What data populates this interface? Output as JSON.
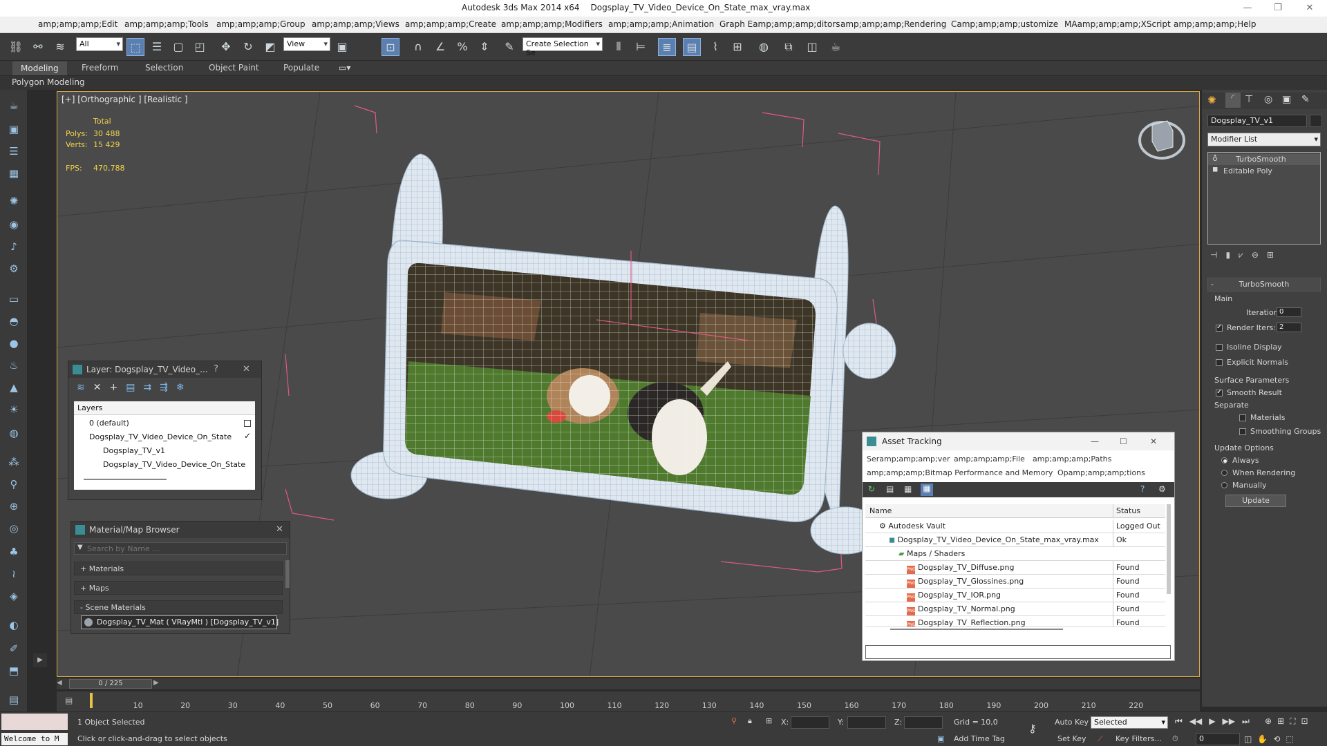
{
  "window": {
    "app_title": "Autodesk 3ds Max  2014 x64",
    "file_title": "Dogsplay_TV_Video_Device_On_State_max_vray.max",
    "minimize": "—",
    "restore": "❐",
    "close": "✕"
  },
  "menu": [
    "amp;amp;amp;Edit",
    "amp;amp;amp;Tools",
    "amp;amp;amp;Group",
    "amp;amp;amp;Views",
    "amp;amp;amp;Create",
    "amp;amp;amp;Modifiers",
    "amp;amp;amp;Animation",
    "Graph Eamp;amp;amp;ditors",
    "amp;amp;amp;Rendering",
    "Camp;amp;amp;ustomize",
    "MAamp;amp;amp;XScript",
    "amp;amp;amp;Help"
  ],
  "toolbar": {
    "selection_filter": "All",
    "ref_coord": "View",
    "named_selection": "Create Selection Se"
  },
  "ribbon": {
    "tabs": [
      "Modeling",
      "Freeform",
      "Selection",
      "Object Paint",
      "Populate"
    ],
    "active": "Modeling",
    "sub_label": "Polygon Modeling"
  },
  "viewport": {
    "label": "[+] [Orthographic ] [Realistic ]",
    "stats_total": "Total",
    "polys_label": "Polys:",
    "polys_value": "30 488",
    "verts_label": "Verts:",
    "verts_value": "15 429",
    "fps_label": "FPS:",
    "fps_value": "470,788"
  },
  "layer_panel": {
    "title": "Layer: Dogsplay_TV_Video_...",
    "help": "?",
    "close": "✕",
    "header": "Layers",
    "rows": [
      "0 (default)",
      "Dogsplay_TV_Video_Device_On_State",
      "Dogsplay_TV_v1",
      "Dogsplay_TV_Video_Device_On_State"
    ]
  },
  "material_browser": {
    "title": "Material/Map Browser",
    "close": "✕",
    "search_placeholder": "Search by Name ...",
    "groups": [
      "+ Materials",
      "+ Maps",
      "- Scene Materials"
    ],
    "scene_material": "Dogsplay_TV_Mat ( VRayMtl ) [Dogsplay_TV_v1]"
  },
  "asset_tracking": {
    "title": "Asset Tracking",
    "menu": [
      "Seramp;amp;amp;ver",
      "amp;amp;amp;File",
      "amp;amp;amp;Paths",
      "amp;amp;amp;Bitmap Performance and Memory",
      "Opamp;amp;amp;tions"
    ],
    "col_name": "Name",
    "col_status": "Status",
    "rows": [
      {
        "name": "Autodesk Vault",
        "status": "Logged Out"
      },
      {
        "name": "Dogsplay_TV_Video_Device_On_State_max_vray.max",
        "status": "Ok"
      },
      {
        "name": "Maps / Shaders",
        "status": ""
      },
      {
        "name": "Dogsplay_TV_Diffuse.png",
        "status": "Found"
      },
      {
        "name": "Dogsplay_TV_Glossines.png",
        "status": "Found"
      },
      {
        "name": "Dogsplay_TV_IOR.png",
        "status": "Found"
      },
      {
        "name": "Dogsplay_TV_Normal.png",
        "status": "Found"
      },
      {
        "name": "Dogsplay_TV_Reflection.png",
        "status": "Found"
      }
    ],
    "png_badge": "PNG"
  },
  "command_panel": {
    "object_name": "Dogsplay_TV_v1",
    "modifier_list": "Modifier List",
    "stack": [
      "TurboSmooth",
      "Editable Poly"
    ],
    "rollout_title": "TurboSmooth",
    "main_label": "Main",
    "iterations_label": "Iterations:",
    "iterations_value": "0",
    "render_iters_label": "Render Iters:",
    "render_iters_value": "2",
    "isoline": "Isoline Display",
    "explicit_normals": "Explicit Normals",
    "surface_params": "Surface Parameters",
    "smooth_result": "Smooth Result",
    "separate": "Separate",
    "materials": "Materials",
    "smoothing_groups": "Smoothing Groups",
    "update_options": "Update Options",
    "always": "Always",
    "when_rendering": "When Rendering",
    "manually": "Manually",
    "update_btn": "Update"
  },
  "timeline": {
    "frame": "0 / 225",
    "ticks": [
      "10",
      "20",
      "30",
      "40",
      "50",
      "60",
      "70",
      "80",
      "90",
      "100",
      "110",
      "120",
      "130",
      "140",
      "150",
      "160",
      "170",
      "180",
      "190",
      "200",
      "210",
      "220"
    ]
  },
  "status": {
    "maxscript": "Welcome to M",
    "selected": "1 Object Selected",
    "prompt": "Click or click-and-drag to select objects",
    "x_label": "X:",
    "y_label": "Y:",
    "z_label": "Z:",
    "grid": "Grid = 10,0",
    "add_time_tag": "Add Time Tag",
    "auto_key": "Auto Key",
    "set_key": "Set Key",
    "selected_dropdown": "Selected",
    "key_filters": "Key Filters...",
    "frame_field": "0"
  },
  "colors": {
    "accent": "#5a7fb0",
    "viewport_border": "#d7a74a",
    "stats": "#f2d44a",
    "wire": "#e8eef4"
  }
}
